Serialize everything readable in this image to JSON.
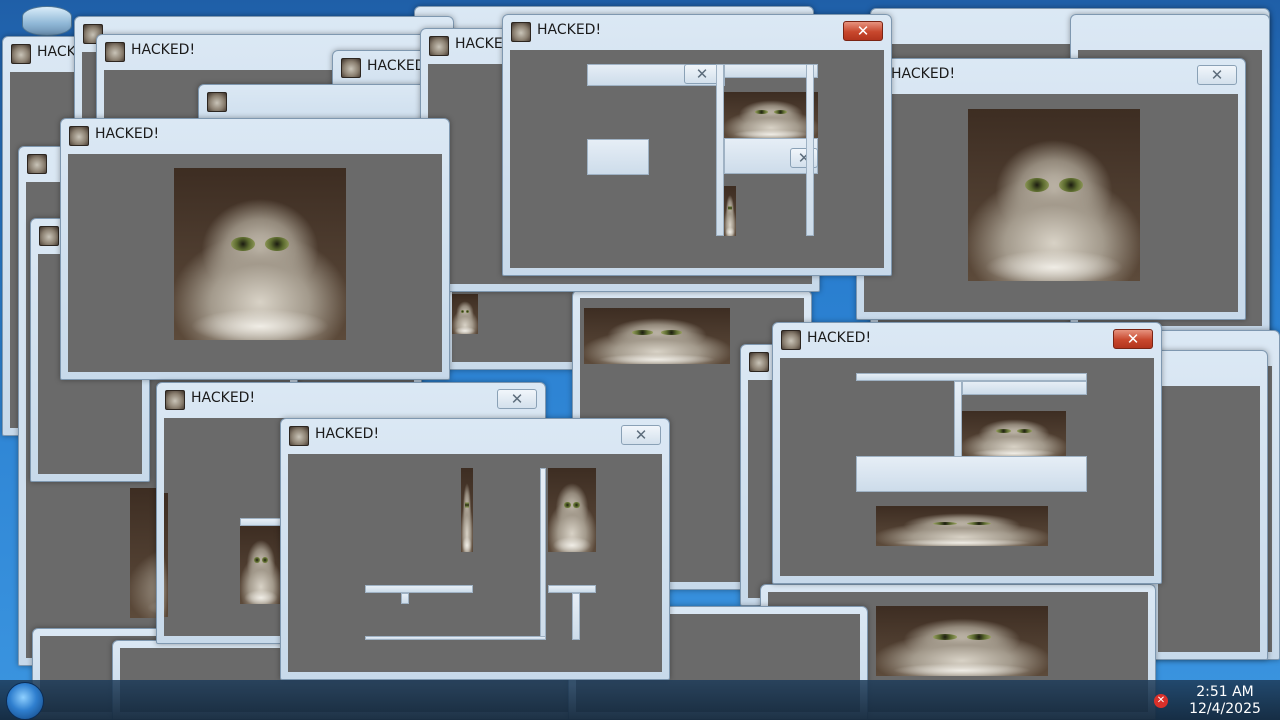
{
  "desktop": {
    "recycle_bin_icon": "recycle-bin-icon",
    "cursor_icon": "mouse-pointer-icon"
  },
  "window": {
    "title": "HACKED!",
    "close_glyph": "✕",
    "app_icon": "cat-face-icon",
    "image_subject": "cat-photo"
  },
  "taskbar": {
    "start_icon": "windows-start-orb-icon",
    "tray_icon": "red-x-alert-icon",
    "tray_glyph": "✕",
    "time": "2:51 AM",
    "date": "12/4/2025"
  },
  "colors": {
    "client_area": "#6a6a6a",
    "close_active": "#c8472d",
    "desktop": "#2a7fd0"
  }
}
